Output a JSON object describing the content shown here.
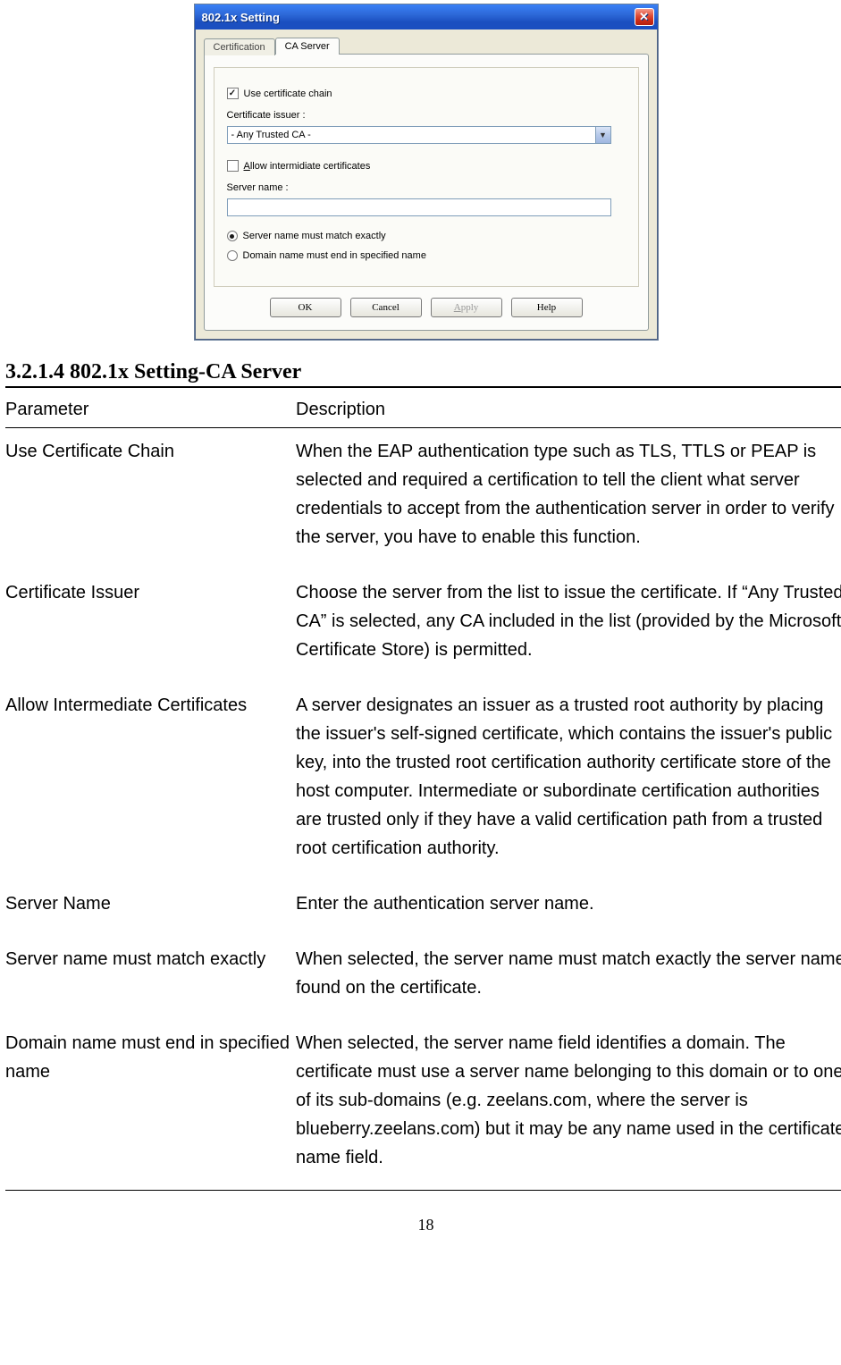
{
  "dialog": {
    "title": "802.1x Setting",
    "tabs": {
      "certification": "Certification",
      "ca_server": "CA Server"
    },
    "use_chain_label": "Use certificate chain",
    "use_chain_checked": true,
    "issuer_label": "Certificate issuer :",
    "issuer_selected": "- Any Trusted CA -",
    "allow_inter_label_prefix": "A",
    "allow_inter_label_rest": "llow intermidiate certificates",
    "allow_inter_checked": false,
    "server_name_label": "Server name :",
    "server_name_value": "",
    "radio_exact": "Server name must match exactly",
    "radio_domain": "Domain name must end in specified name",
    "radio_selected": "exact",
    "buttons": {
      "ok": "OK",
      "cancel": "Cancel",
      "apply_prefix": "A",
      "apply_rest": "pply",
      "help": "Help"
    }
  },
  "doc": {
    "heading_prefix": "3.2.1.4  ",
    "heading": "802.1x Setting-CA Server",
    "table": {
      "head_param": "Parameter",
      "head_desc": "Description",
      "rows": [
        {
          "param": "Use Certificate Chain",
          "desc": "When the EAP authentication type such as TLS, TTLS or PEAP is selected and required a certification to tell the client what server credentials to accept from the authentication server in order to verify the server, you have to enable this function."
        },
        {
          "param": "Certificate Issuer",
          "desc": "Choose the server from the list to issue the certificate. If “Any Trusted CA” is selected, any CA included in the list (provided by the Microsoft Certificate Store) is permitted."
        },
        {
          "param": "Allow Intermediate Certificates",
          "desc": "A server designates an issuer as a trusted root authority by placing the issuer's self-signed certificate, which contains the issuer's public key, into the trusted root certification authority certificate store of the host computer. Intermediate or subordinate certification authorities are trusted only if they have a valid certification path from a trusted root certification authority."
        },
        {
          "param": "Server Name",
          "desc": "Enter the authentication server name."
        },
        {
          "param": "Server name must match exactly",
          "desc": "When selected, the server name must match exactly the server name found on the certificate."
        },
        {
          "param": "Domain name must end in specified name",
          "desc": "When selected, the server name field identifies a domain. The certificate must use a server name belonging to this domain or to one of its sub-domains (e.g. zeelans.com, where the server is blueberry.zeelans.com) but it may be any name used in the certificate name field."
        }
      ]
    },
    "page_number": "18"
  }
}
